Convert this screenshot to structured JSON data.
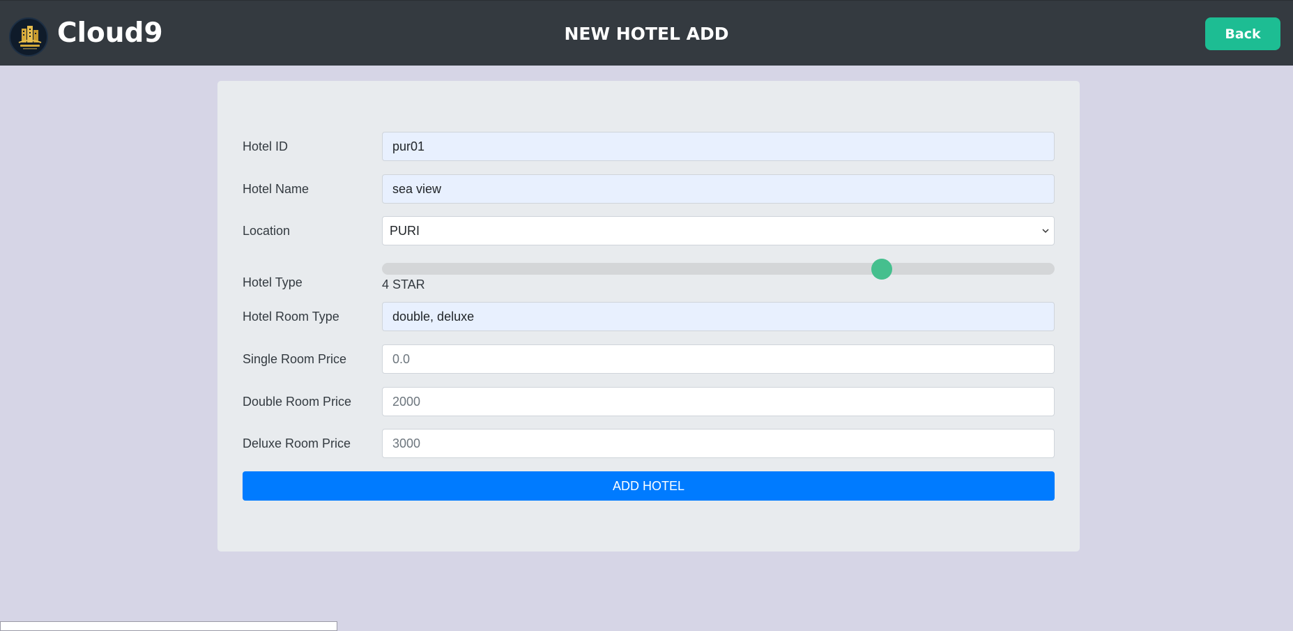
{
  "header": {
    "brand": "Cloud9",
    "logo_icon": "hotel-building-logo",
    "title": "NEW HOTEL ADD",
    "back_label": "Back"
  },
  "form": {
    "hotel_id": {
      "label": "Hotel ID",
      "value": "pur01"
    },
    "hotel_name": {
      "label": "Hotel Name",
      "value": "sea view"
    },
    "location": {
      "label": "Location",
      "selected": "PURI"
    },
    "hotel_type": {
      "label": "Hotel Type",
      "value_text": "4 STAR",
      "slider_fraction": 0.743
    },
    "room_type": {
      "label": "Hotel Room Type",
      "value": "double, deluxe"
    },
    "single_price": {
      "label": "Single Room Price",
      "value": "0.0"
    },
    "double_price": {
      "label": "Double Room Price",
      "value": "2000"
    },
    "deluxe_price": {
      "label": "Deluxe Room Price",
      "value": "3000"
    },
    "submit_label": "ADD HOTEL"
  },
  "colors": {
    "header_bg": "#343a40",
    "page_bg": "#d6d5e6",
    "back_button": "#1dbd93",
    "submit_button": "#007bff",
    "slider_thumb": "#45bf8e"
  }
}
